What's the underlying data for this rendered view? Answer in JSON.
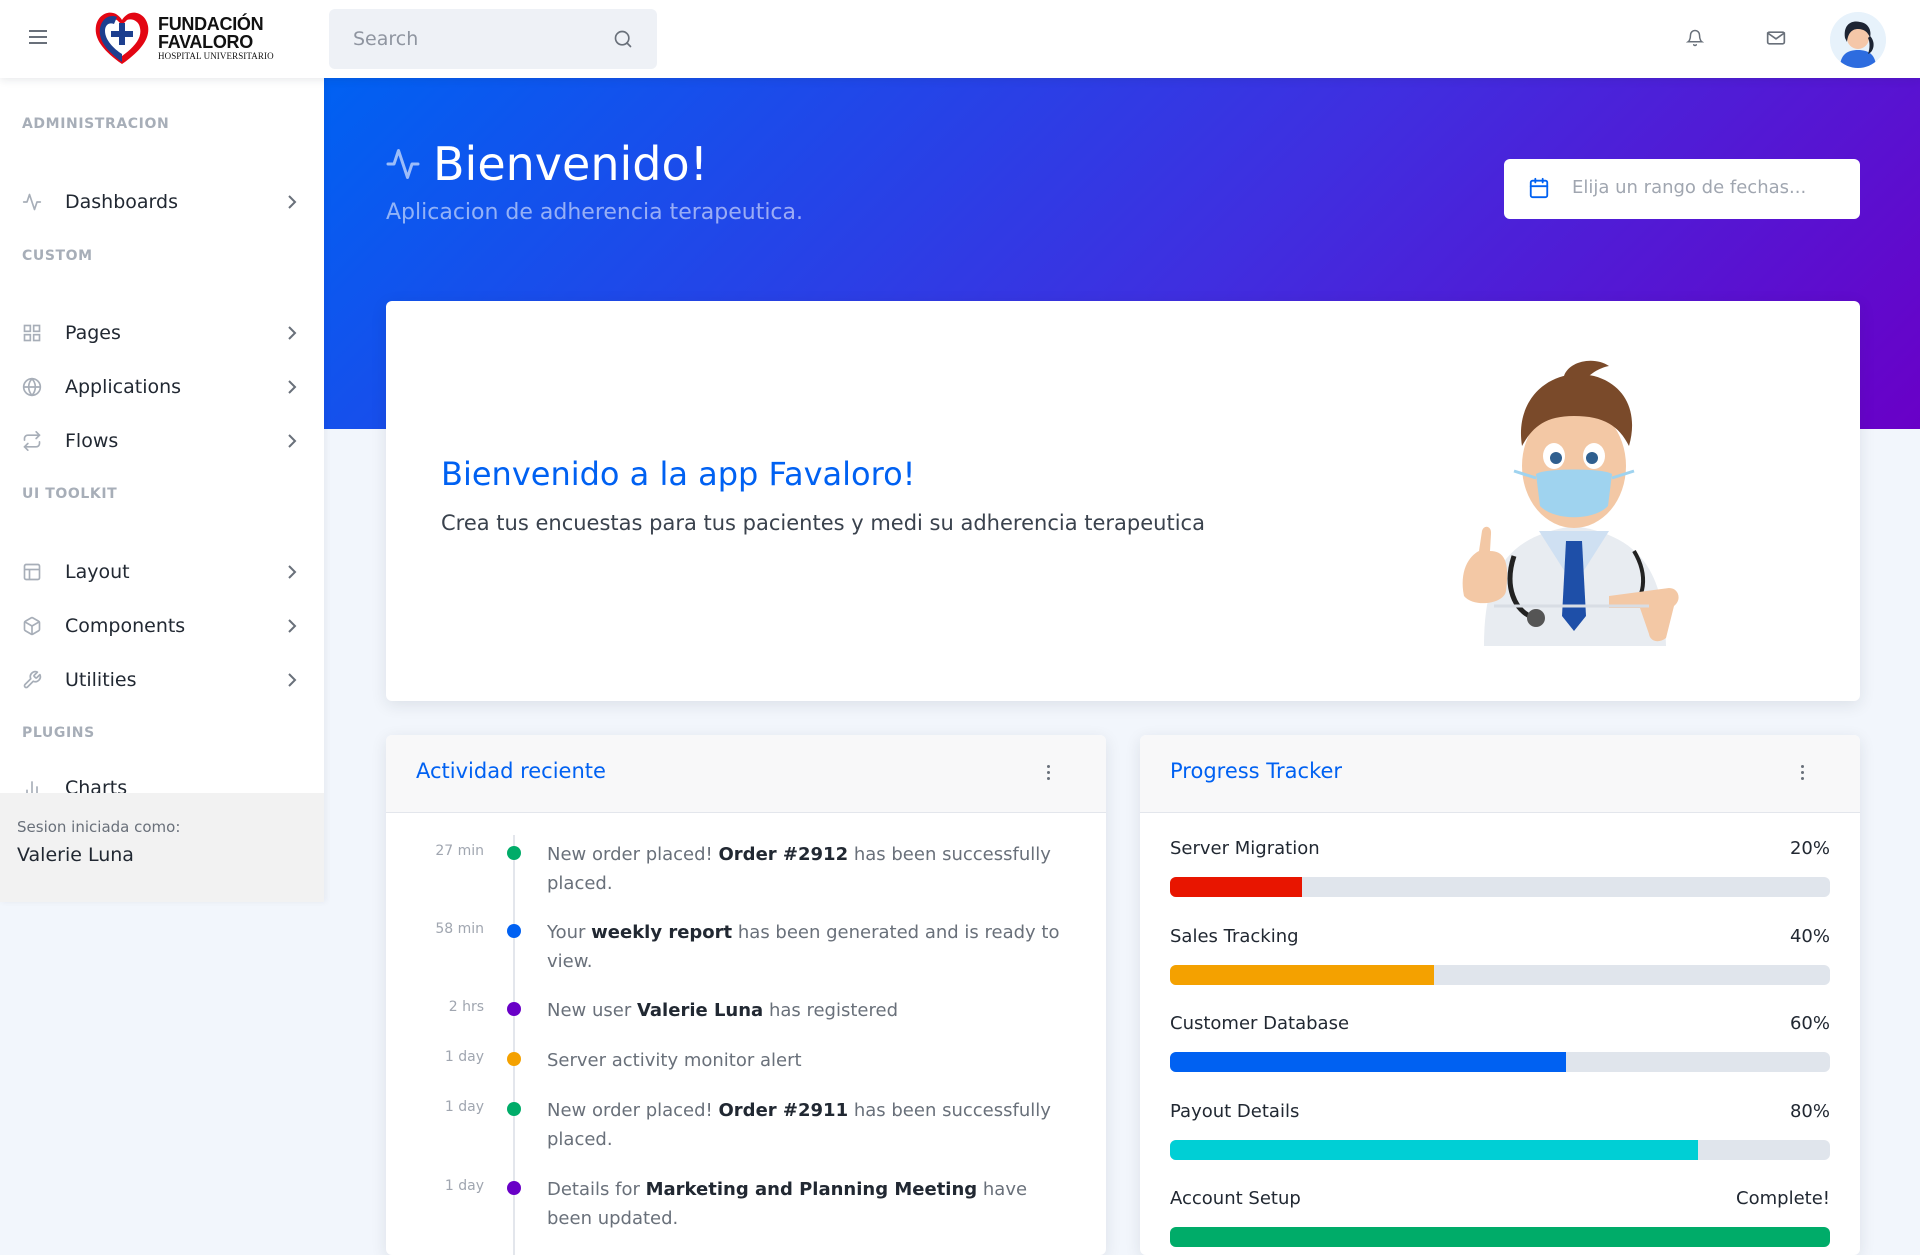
{
  "brand": {
    "line1": "FUNDACIÓN",
    "line2": "FAVALORO",
    "line3": "HOSPITAL UNIVERSITARIO"
  },
  "search": {
    "placeholder": "Search"
  },
  "sidebar": {
    "sections": [
      {
        "title": "ADMINISTRACION"
      },
      {
        "title": "CUSTOM"
      },
      {
        "title": "UI TOOLKIT"
      },
      {
        "title": "PLUGINS"
      }
    ],
    "items": [
      {
        "label": "Dashboards",
        "icon": "activity-icon"
      },
      {
        "label": "Pages",
        "icon": "grid-icon"
      },
      {
        "label": "Applications",
        "icon": "globe-icon"
      },
      {
        "label": "Flows",
        "icon": "repeat-icon"
      },
      {
        "label": "Layout",
        "icon": "layout-icon"
      },
      {
        "label": "Components",
        "icon": "package-icon"
      },
      {
        "label": "Utilities",
        "icon": "tool-icon"
      },
      {
        "label": "Charts",
        "icon": "bar-chart-icon"
      }
    ],
    "footer": {
      "caption": "Sesion iniciada como:",
      "user": "Valerie Luna"
    }
  },
  "header": {
    "title": "Bienvenido!",
    "subtitle": "Aplicacion de adherencia terapeutica.",
    "date_placeholder": "Elija un rango de fechas..."
  },
  "welcome": {
    "title": "Bienvenido a la app Favaloro!",
    "text": "Crea tus encuestas para tus pacientes y medi su adherencia terapeutica"
  },
  "activity": {
    "title": "Actividad reciente",
    "items": [
      {
        "time": "27 min",
        "color": "#00ac69",
        "pre": "New order placed! ",
        "bold": "Order #2912",
        "post": " has been successfully placed."
      },
      {
        "time": "58 min",
        "color": "#0061f2",
        "pre": "Your ",
        "bold": "weekly report",
        "post": " has been generated and is ready to view."
      },
      {
        "time": "2 hrs",
        "color": "#6900c7",
        "pre": "New user ",
        "bold": "Valerie Luna",
        "post": " has registered"
      },
      {
        "time": "1 day",
        "color": "#f4a100",
        "pre": "Server activity monitor alert",
        "bold": "",
        "post": ""
      },
      {
        "time": "1 day",
        "color": "#00ac69",
        "pre": "New order placed! ",
        "bold": "Order #2911",
        "post": " has been successfully placed."
      },
      {
        "time": "1 day",
        "color": "#6900c7",
        "pre": "Details for ",
        "bold": "Marketing and Planning Meeting",
        "post": " have been updated."
      }
    ]
  },
  "progress": {
    "title": "Progress Tracker",
    "items": [
      {
        "name": "Server Migration",
        "label": "20%",
        "value": 0.2,
        "color": "#e81500"
      },
      {
        "name": "Sales Tracking",
        "label": "40%",
        "value": 0.4,
        "color": "#f4a100"
      },
      {
        "name": "Customer Database",
        "label": "60%",
        "value": 0.6,
        "color": "#0061f2"
      },
      {
        "name": "Payout Details",
        "label": "80%",
        "value": 0.8,
        "color": "#00cfd5"
      },
      {
        "name": "Account Setup",
        "label": "Complete!",
        "value": 1.0,
        "color": "#00ac69"
      }
    ]
  }
}
